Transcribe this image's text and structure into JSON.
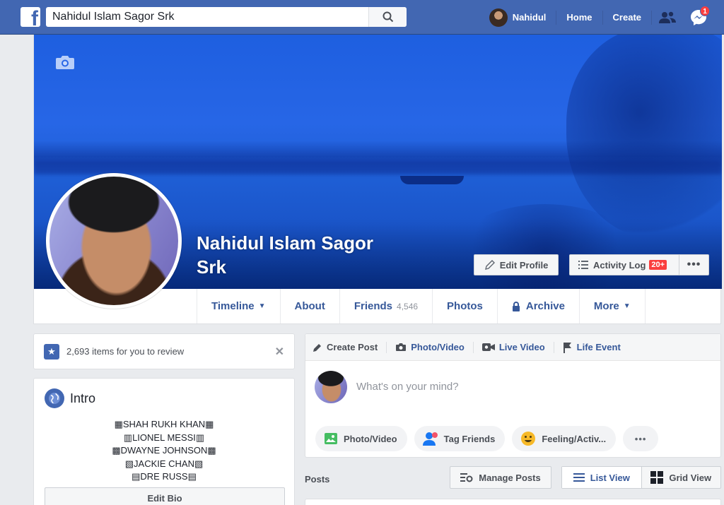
{
  "topbar": {
    "search_value": "Nahidul Islam Sagor Srk",
    "user_name": "Nahidul",
    "home_label": "Home",
    "create_label": "Create",
    "messages_badge": "1",
    "brand_color": "#4267b2"
  },
  "profile": {
    "name": "Nahidul Islam Sagor Srk",
    "edit_profile_label": "Edit Profile",
    "activity_log_label": "Activity Log",
    "activity_log_badge": "20+",
    "more_label": "•••"
  },
  "tabs": [
    {
      "label": "Timeline",
      "caret": "▼"
    },
    {
      "label": "About"
    },
    {
      "label": "Friends",
      "count": "4,546"
    },
    {
      "label": "Photos"
    },
    {
      "label": "Archive"
    },
    {
      "label": "More",
      "caret": "▼"
    }
  ],
  "review": {
    "text": "2,693 items for you to review",
    "close": "✕"
  },
  "intro": {
    "title": "Intro",
    "bio_lines": [
      "▦SHAH RUKH KHAN▦",
      "▥LIONEL MESSI▥",
      "▩DWAYNE JOHNSON▩",
      "▧JACKIE CHAN▧",
      "▤DRE RUSS▤"
    ],
    "edit_bio_label": "Edit Bio"
  },
  "composer": {
    "tabs": [
      "Create Post",
      "Photo/Video",
      "Live Video",
      "Life Event"
    ],
    "placeholder": "What's on your mind?",
    "actions": [
      "Photo/Video",
      "Tag Friends",
      "Feeling/Activ..."
    ],
    "more_label": "•••"
  },
  "posts": {
    "label": "Posts",
    "manage_label": "Manage Posts",
    "list_view_label": "List View",
    "grid_view_label": "Grid View"
  }
}
